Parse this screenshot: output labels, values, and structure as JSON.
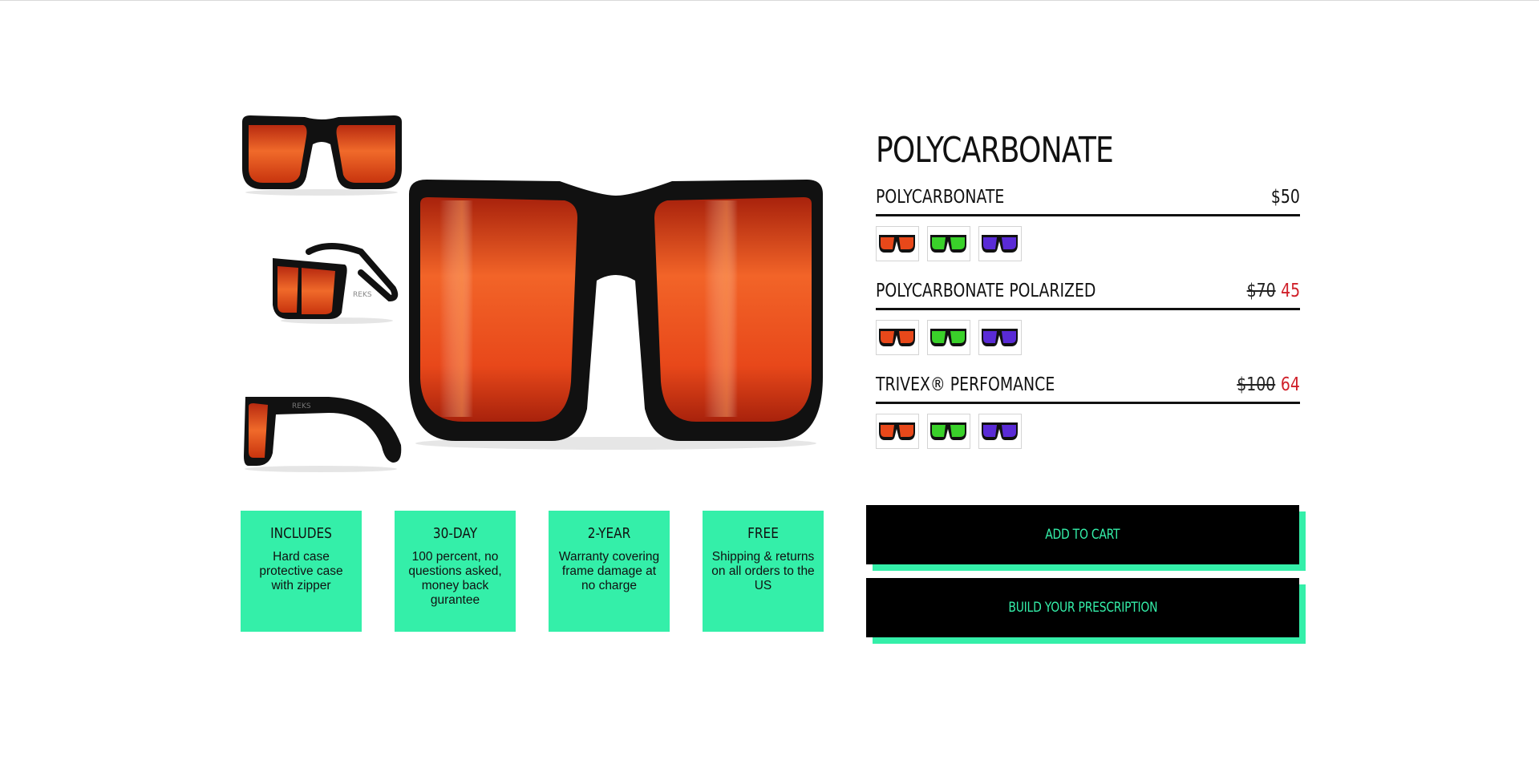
{
  "product": {
    "title": "POLYCARBONATE"
  },
  "gallery": {
    "thumbnails": [
      {
        "alt": "front view"
      },
      {
        "alt": "angled view"
      },
      {
        "alt": "side view"
      }
    ],
    "logo_text": "REKS"
  },
  "variants": [
    {
      "name": "POLYCARBONATE",
      "price": "$50",
      "old_price": "",
      "sale_price": "",
      "swatches": [
        "red-mirror",
        "green-mirror",
        "purple-mirror"
      ]
    },
    {
      "name": "POLYCARBONATE POLARIZED",
      "price": "",
      "old_price": "$70",
      "sale_price": "45",
      "swatches": [
        "red-mirror",
        "green-mirror",
        "purple-mirror"
      ]
    },
    {
      "name": "TRIVEX® PERFOMANCE",
      "price": "",
      "old_price": "$100",
      "sale_price": "64",
      "swatches": [
        "red-mirror",
        "green-mirror",
        "purple-mirror"
      ]
    }
  ],
  "features": [
    {
      "heading": "INCLUDES",
      "text": "Hard case protective case with zipper"
    },
    {
      "heading": "30-DAY",
      "text": "100 percent, no questions asked, money back gurantee"
    },
    {
      "heading": "2-YEAR",
      "text": "Warranty covering frame damage at no charge"
    },
    {
      "heading": "FREE",
      "text": "Shipping & returns on all orders to the US"
    }
  ],
  "actions": {
    "add_to_cart": "ADD TO CART",
    "build_prescription": "BUILD YOUR PRESCRIPTION"
  },
  "colors": {
    "accent": "#34efa9",
    "sale": "#d0202a",
    "lens_red": "#e8481a",
    "lens_green": "#3ad12a",
    "lens_purple": "#5a2bd6"
  }
}
